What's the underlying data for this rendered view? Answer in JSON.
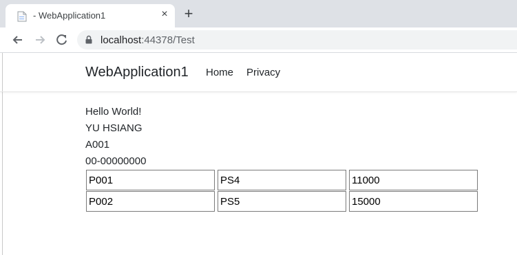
{
  "browser": {
    "tab_title": "- WebApplication1",
    "close_glyph": "×",
    "new_tab_glyph": "+",
    "url_host": "localhost",
    "url_path": ":44378/Test"
  },
  "site": {
    "brand": "WebApplication1",
    "nav": [
      "Home",
      "Privacy"
    ]
  },
  "content": {
    "lines": [
      "Hello World!",
      "YU HSIANG",
      "A001",
      "00-00000000"
    ],
    "table": [
      [
        "P001",
        "PS4",
        "11000"
      ],
      [
        "P002",
        "PS5",
        "15000"
      ]
    ]
  },
  "icons": [
    "document-favicon-icon",
    "close-icon",
    "plus-icon",
    "back-arrow-icon",
    "forward-arrow-icon",
    "reload-icon",
    "lock-icon"
  ]
}
